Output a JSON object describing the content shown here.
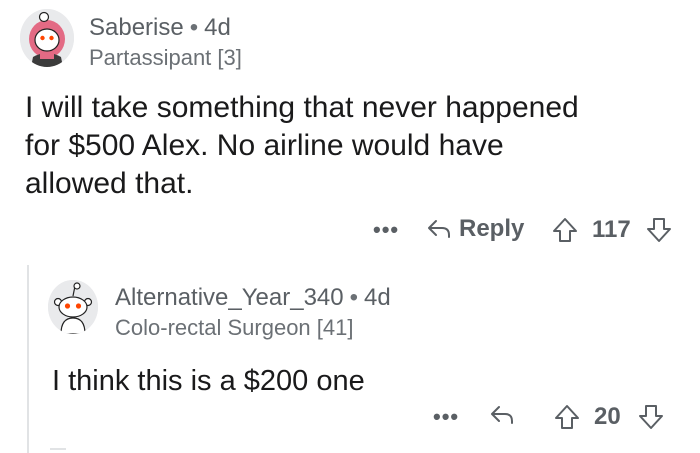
{
  "top_comment": {
    "username": "Saberise",
    "separator": "•",
    "age": "4d",
    "flair": "Partassipant [3]",
    "body_lines": [
      "I will take something that never happened",
      "for $500 Alex. No airline would have",
      "allowed that."
    ],
    "actions": {
      "more": "•••",
      "reply_label": "Reply",
      "score": "117"
    }
  },
  "reply_comment": {
    "username": "Alternative_Year_340",
    "separator": "•",
    "age": "4d",
    "flair": "Colo-rectal Surgeon [41]",
    "body": "I think this is a $200 one",
    "actions": {
      "more": "•••",
      "score": "20"
    }
  },
  "icons": {
    "reply": "reply-arrow-icon",
    "upvote": "upvote-arrow-icon",
    "downvote": "downvote-arrow-icon",
    "more": "ellipsis-icon"
  },
  "colors": {
    "meta_text": "#5a5f64",
    "body_text": "#1a1a1b",
    "thread_line": "#e1e3e5",
    "avatar_pink": "#e36a84",
    "snoo_orange": "#ff4500"
  }
}
